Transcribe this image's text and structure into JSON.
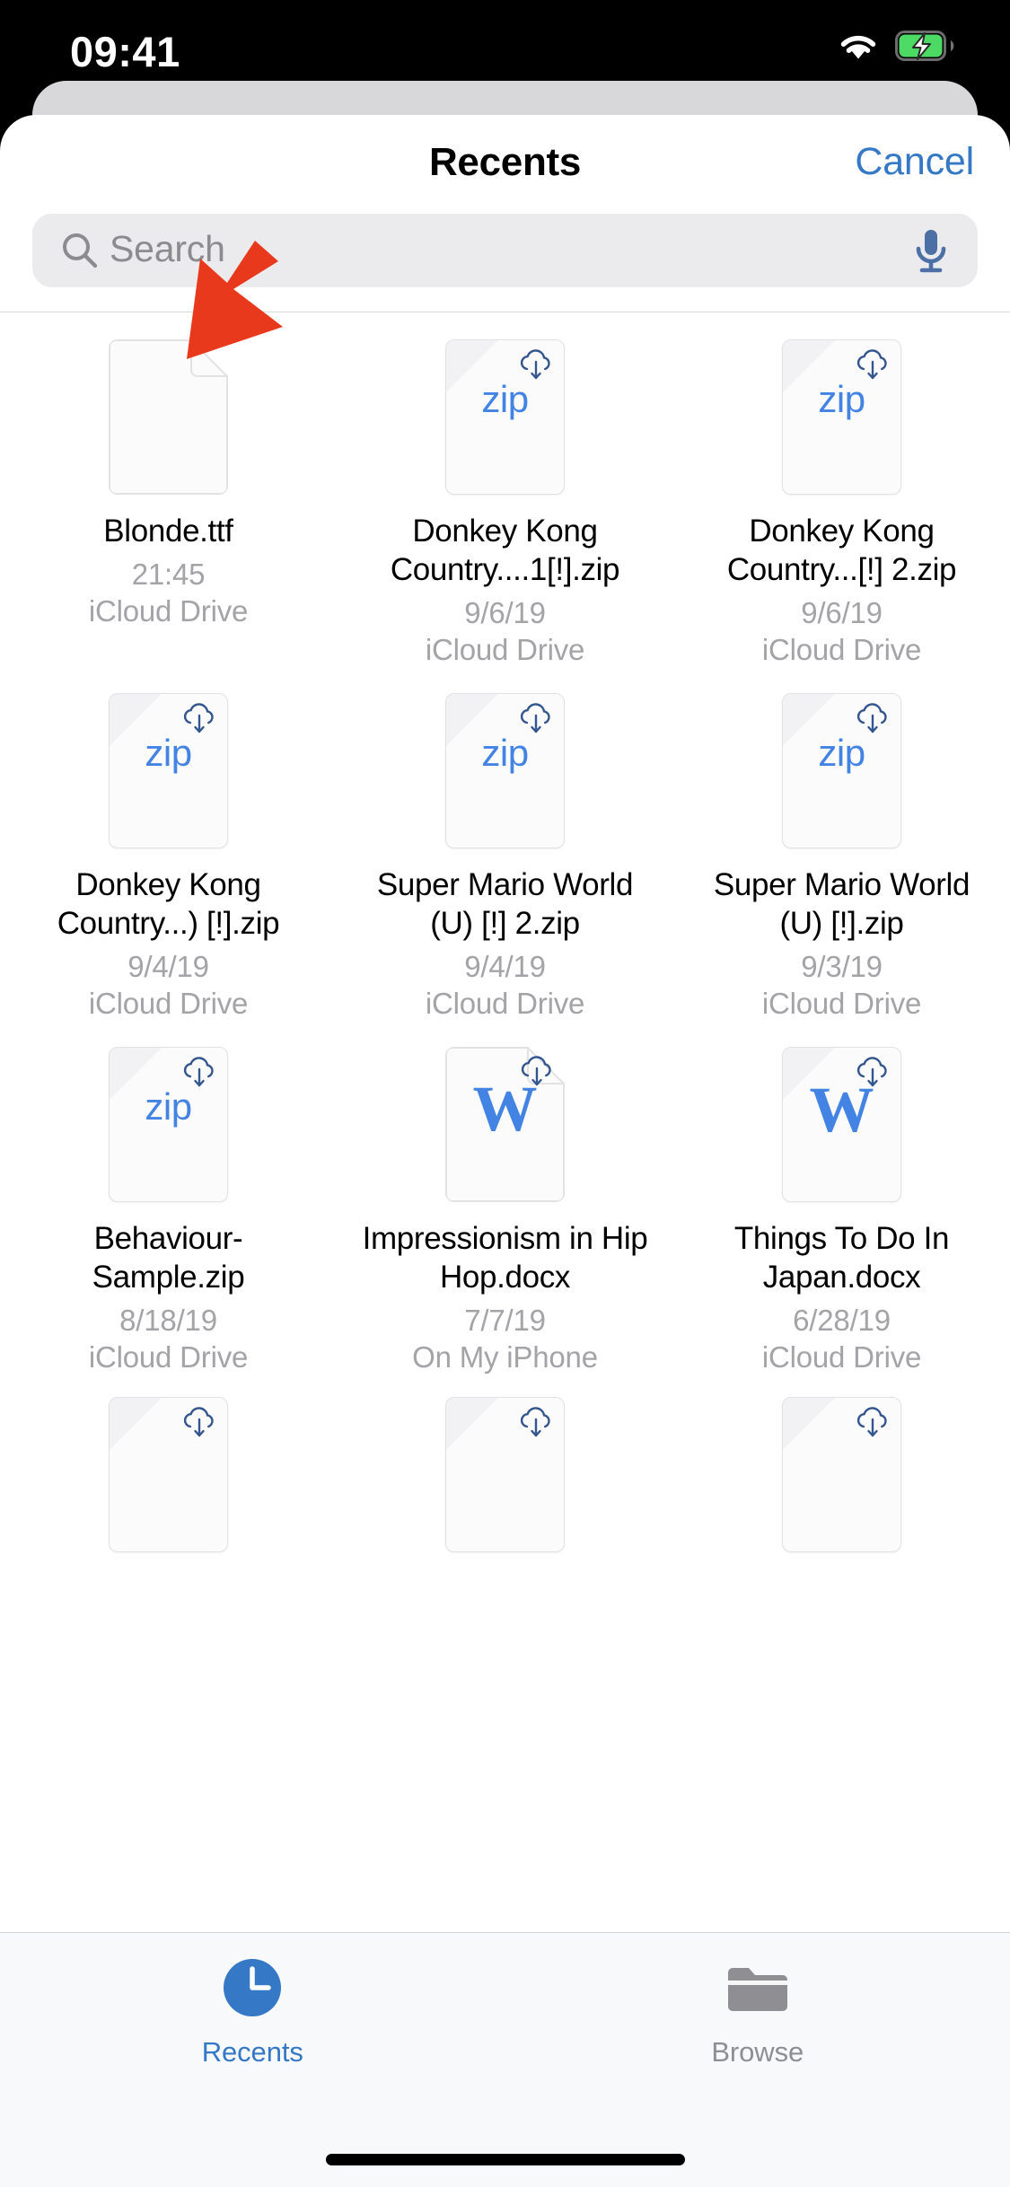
{
  "status_bar": {
    "time": "09:41",
    "wifi_icon": "wifi-icon",
    "battery_icon": "battery-charging-icon",
    "battery_color": "#4cd964"
  },
  "nav": {
    "title": "Recents",
    "cancel_label": "Cancel",
    "accent_color": "#3478c6"
  },
  "search": {
    "placeholder": "Search",
    "search_icon": "search-icon",
    "mic_icon": "microphone-icon"
  },
  "annotation": {
    "arrow_icon": "red-arrow-pointer",
    "color": "#e8391c"
  },
  "files": [
    {
      "name": "Blonde.ttf",
      "date": "21:45",
      "location": "iCloud Drive",
      "icon_type": "blank-folded",
      "icon_label": "",
      "cloud_badge": false
    },
    {
      "name": "Donkey Kong Country....1[!].zip",
      "date": "9/6/19",
      "location": "iCloud Drive",
      "icon_type": "zip",
      "icon_label": "zip",
      "cloud_badge": true
    },
    {
      "name": "Donkey Kong Country...[!] 2.zip",
      "date": "9/6/19",
      "location": "iCloud Drive",
      "icon_type": "zip",
      "icon_label": "zip",
      "cloud_badge": true
    },
    {
      "name": "Donkey Kong Country...) [!].zip",
      "date": "9/4/19",
      "location": "iCloud Drive",
      "icon_type": "zip",
      "icon_label": "zip",
      "cloud_badge": true
    },
    {
      "name": "Super Mario World (U) [!] 2.zip",
      "date": "9/4/19",
      "location": "iCloud Drive",
      "icon_type": "zip",
      "icon_label": "zip",
      "cloud_badge": true
    },
    {
      "name": "Super Mario World (U) [!].zip",
      "date": "9/3/19",
      "location": "iCloud Drive",
      "icon_type": "zip",
      "icon_label": "zip",
      "cloud_badge": true
    },
    {
      "name": "Behaviour-Sample.zip",
      "date": "8/18/19",
      "location": "iCloud Drive",
      "icon_type": "zip",
      "icon_label": "zip",
      "cloud_badge": true
    },
    {
      "name": "Impressionism in Hip Hop.docx",
      "date": "7/7/19",
      "location": "On My iPhone",
      "icon_type": "word-folded",
      "icon_label": "W",
      "cloud_badge": true
    },
    {
      "name": "Things To Do In Japan.docx",
      "date": "6/28/19",
      "location": "iCloud Drive",
      "icon_type": "word",
      "icon_label": "W",
      "cloud_badge": true
    }
  ],
  "partial_row": [
    {
      "icon_type": "zip",
      "cloud_badge": true
    },
    {
      "icon_type": "zip",
      "cloud_badge": true
    },
    {
      "icon_type": "zip",
      "cloud_badge": true
    }
  ],
  "tab_bar": {
    "tabs": [
      {
        "label": "Recents",
        "icon": "clock-icon",
        "active": true
      },
      {
        "label": "Browse",
        "icon": "folder-icon",
        "active": false
      }
    ],
    "active_color": "#3478c6",
    "inactive_color": "#8e8e93"
  }
}
